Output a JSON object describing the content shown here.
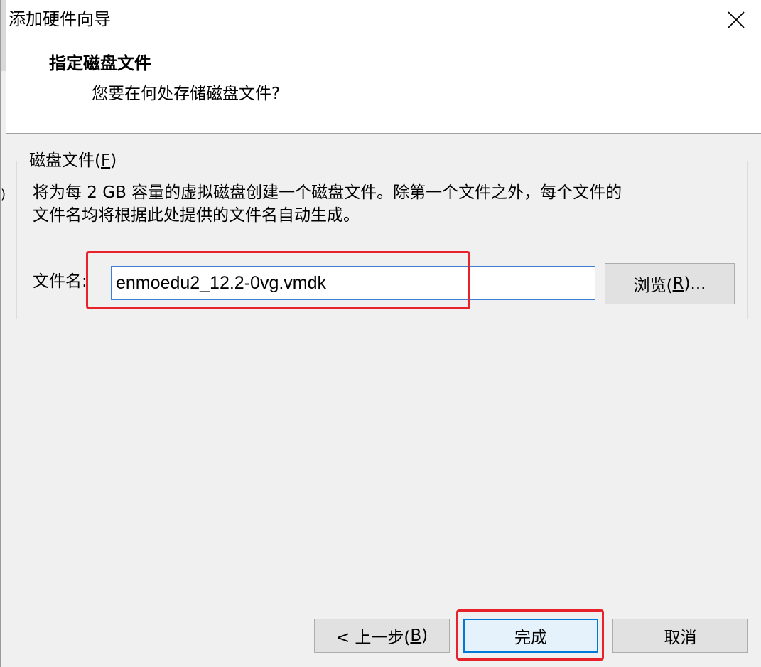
{
  "window": {
    "title": "添加硬件向导"
  },
  "header": {
    "title": "指定磁盘文件",
    "subtitle": "您要在何处存储磁盘文件?"
  },
  "disk_file_group": {
    "legend_prefix": "磁盘文件(",
    "legend_key": "F",
    "legend_suffix": ")",
    "description": "将为每 2 GB 容量的虚拟磁盘创建一个磁盘文件。除第一个文件之外，每个文件的\n文件名均将根据此处提供的文件名自动生成。",
    "file_name_label": "文件名:",
    "file_name_value": "enmoedu2_12.2-0vg.vmdk",
    "browse_prefix": "浏览(",
    "browse_key": "R",
    "browse_suffix": ")..."
  },
  "footer": {
    "back_prefix": "< 上一步(",
    "back_key": "B",
    "back_suffix": ")",
    "finish_label": "完成",
    "cancel_label": "取消"
  },
  "background_edge_text": ")",
  "colors": {
    "highlight": "#e8222b",
    "focus_border": "#0078d7",
    "input_border": "#3c7fd4"
  },
  "icons": {
    "close": "close-icon"
  }
}
